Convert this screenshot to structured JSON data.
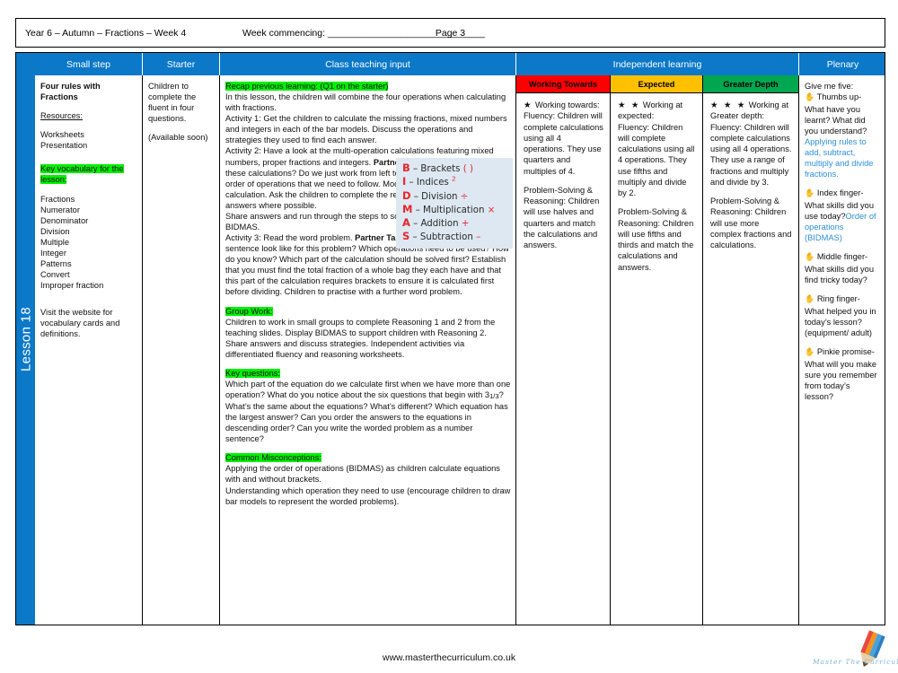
{
  "header": {
    "title": "Year 6 – Autumn – Fractions – Week 4",
    "week_commencing": "Week commencing: ______________________________",
    "page": "Page 3"
  },
  "spine": {
    "lesson_label": "Lesson 18"
  },
  "columns": [
    {
      "label": "Small step"
    },
    {
      "label": "Starter"
    },
    {
      "label": "Class teaching input"
    },
    {
      "label": "Independent learning"
    },
    {
      "label": "Plenary"
    }
  ],
  "small_step": {
    "title": "Four rules with Fractions",
    "resources_heading": "Resources:",
    "resources": "Worksheets\nPresentation",
    "vocab_heading": "Key vocabulary for the lesson:",
    "vocab": [
      "Fractions",
      "Numerator",
      "Denominator",
      "Division",
      "Multiple",
      "Integer",
      "Patterns",
      "Convert",
      "Improper fraction"
    ],
    "visit_note": "Visit the website for vocabulary cards and definitions."
  },
  "starter": {
    "text": "Children to complete the fluent in four questions.",
    "availability": "(Available soon)"
  },
  "teaching": {
    "recap_heading": "Recap previous learning: (Q1 on the starter)",
    "intro": "In this lesson, the children will combine the four operations when calculating with fractions.",
    "activity1": "Activity 1: Get the children to calculate the missing  fractions, mixed numbers and integers in each of the bar models. Discuss the operations and strategies they used to find each answer.",
    "activity2_a": "Activity 2: Have a look at the multi-operation calculations  featuring mixed numbers, proper fractions and integers. ",
    "activity2_partner_talk": "Partner Talk:",
    "activity2_b": " How would you solve these calculations? Do we just work from left to right? Recap BIDMAS as the order of operations that we need to follow. Model this process with the first calculation. Ask the children to complete the rest; reminding them to simplify answers where possible.",
    "share": "Share answers and run through the steps to solving each calculation using BIDMAS.",
    "activity3_a": "Activity 3: Read the word problem. ",
    "activity3_partner_talk": "Partner Talk:",
    "activity3_b": " What would the number sentence look like for this problem? Which operations need to be used? How do you know? Which part of the calculation should be solved first? Establish that you must find the total  fraction of a whole bag they each have and that this part of the calculation requires brackets to ensure it is calculated first before dividing. Children to practise with a further word problem.",
    "group_work_heading": "Group Work:",
    "group_work": "Children to work in small groups to complete Reasoning 1 and 2 from the teaching slides. Display BIDMAS to support children with Reasoning 2. Share answers and discuss strategies. Independent activities via differentiated fluency and reasoning worksheets.",
    "key_questions_heading": "Key questions:",
    "key_questions_a": "Which part of the equation do we calculate first when we have more than one operation? What do you notice about the six questions that begin with 3",
    "key_questions_frac": "1/3",
    "key_questions_b": "? What’s the same about the equations? What’s different? Which equation has the largest answer? Can you order the answers to the equations in descending order? Can you write the worded problem as a number sentence?",
    "misconceptions_heading": "Common Misconceptions:",
    "misconceptions_1": "Applying the order of operations (BIDMAS) as children calculate equations with and without brackets.",
    "misconceptions_2": "Understanding which operation they need to use (encourage children to draw bar models to represent the worded problems)."
  },
  "bidmas": {
    "rows": [
      {
        "letter": "B",
        "word": "Brackets",
        "symbol": "( )",
        "sup": ""
      },
      {
        "letter": "I",
        "word": "Indices",
        "symbol": "",
        "sup": "2"
      },
      {
        "letter": "D",
        "word": "Division",
        "symbol": "÷",
        "sup": ""
      },
      {
        "letter": "M",
        "word": "Multiplication",
        "symbol": "×",
        "sup": ""
      },
      {
        "letter": "A",
        "word": "Addition",
        "symbol": "+",
        "sup": ""
      },
      {
        "letter": "S",
        "word": "Subtraction",
        "symbol": "–",
        "sup": ""
      }
    ],
    "bg_color": "#dde8f2",
    "letter_color": "#e8242b"
  },
  "independent": [
    {
      "label": "Working Towards",
      "color": "#fe0000",
      "stars": "★",
      "heading": "Working towards:",
      "fluency": "Fluency: Children will complete calculations using all 4 operations. They use quarters and multiples of 4.",
      "reasoning": "Problem-Solving & Reasoning: Children will use halves and quarters and match the calculations and answers."
    },
    {
      "label": "Expected",
      "color": "#ffc000",
      "stars": "★ ★",
      "heading": "Working at expected:",
      "fluency": "Fluency: Children will complete calculations using all 4 operations. They use fifths and multiply and divide by 2.",
      "reasoning": "Problem-Solving & Reasoning: Children will use fifths and thirds and match the calculations and answers."
    },
    {
      "label": "Greater Depth",
      "color": "#00a650",
      "stars": "★ ★ ★",
      "heading": "Working at Greater depth:",
      "fluency": "Fluency: Children will complete calculations using all 4 operations. They use a range of fractions and multiply and divide by 3.",
      "reasoning": "Problem-Solving & Reasoning: Children will use more complex fractions and calculations."
    }
  ],
  "plenary": {
    "intro": "Give me five:",
    "items": [
      {
        "icon": "hand-icon",
        "question": "Thumbs up- What have you learnt? What did you understand?",
        "answer": "Applying rules to add, subtract, multiply and divide fractions."
      },
      {
        "icon": "hand-icon",
        "question": "Index finger- What skills did you use today?",
        "answer": "Order of operations (BIDMAS)"
      },
      {
        "icon": "hand-icon",
        "question": "Middle finger- What skills did you find tricky today?",
        "answer": ""
      },
      {
        "icon": "hand-icon",
        "question": "Ring finger- What helped you in today’s lesson? (equipment/ adult)",
        "answer": ""
      },
      {
        "icon": "hand-icon",
        "question": "Pinkie promise- What will you make sure you remember from today’s lesson?",
        "answer": ""
      }
    ],
    "answer_color": "#2f8fd6"
  },
  "footer": {
    "url": "www.masterthecurriculum.co.uk",
    "logo_text": "Master  The  Curriculum"
  }
}
